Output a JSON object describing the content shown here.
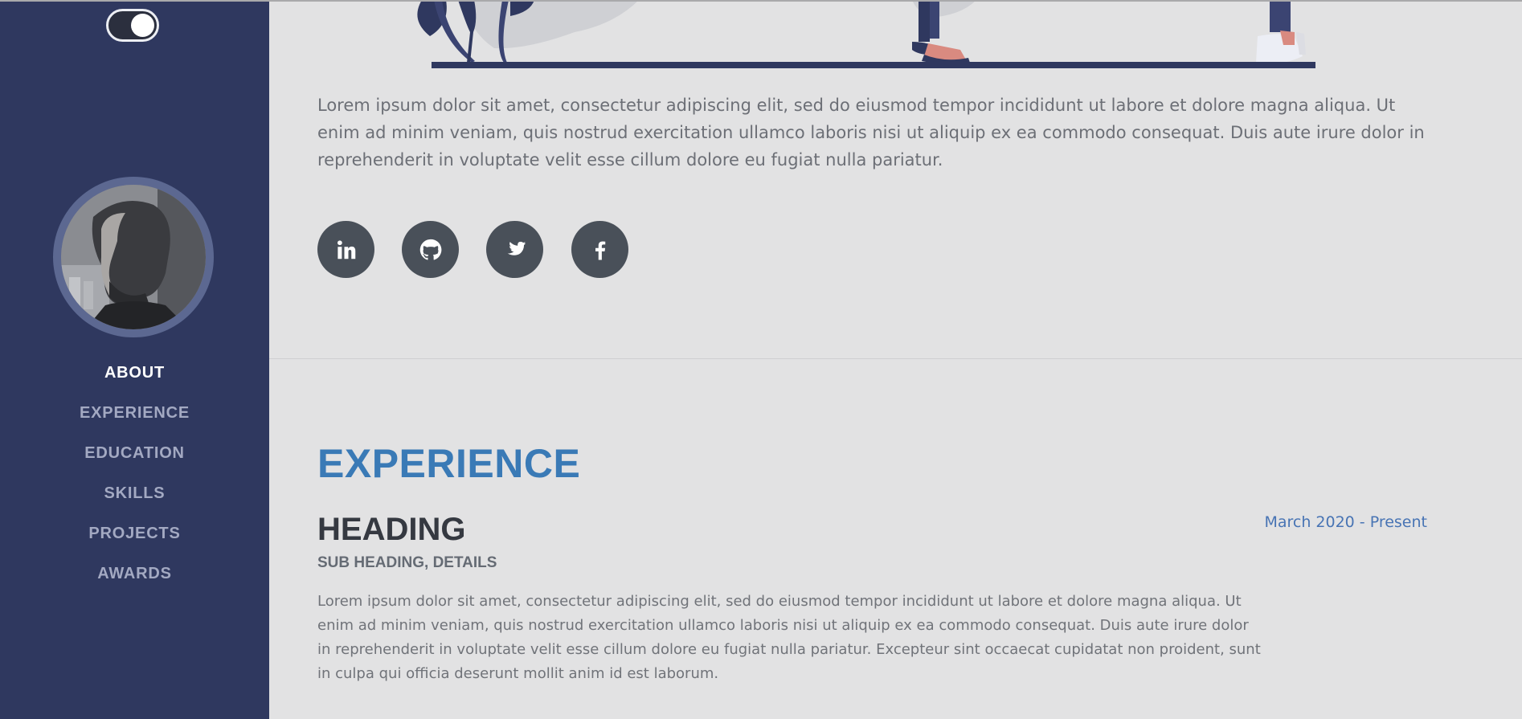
{
  "theme_toggle": {
    "state": "on"
  },
  "sidebar": {
    "avatar_icon": "profile-photo",
    "nav_items": [
      {
        "label": "ABOUT",
        "active": true
      },
      {
        "label": "EXPERIENCE",
        "active": false
      },
      {
        "label": "EDUCATION",
        "active": false
      },
      {
        "label": "SKILLS",
        "active": false
      },
      {
        "label": "PROJECTS",
        "active": false
      },
      {
        "label": "AWARDS",
        "active": false
      }
    ]
  },
  "about": {
    "intro": "Lorem ipsum dolor sit amet, consectetur adipiscing elit, sed do eiusmod tempor incididunt ut labore et dolore magna aliqua. Ut enim ad minim veniam, quis nostrud exercitation ullamco laboris nisi ut aliquip ex ea commodo consequat. Duis aute irure dolor in reprehenderit in voluptate velit esse cillum dolore eu fugiat nulla pariatur.",
    "social_icons": [
      "linkedin-icon",
      "github-icon",
      "twitter-icon",
      "facebook-icon"
    ]
  },
  "experience": {
    "section_title": "EXPERIENCE",
    "entries": [
      {
        "heading": "HEADING",
        "subheading": "SUB HEADING, DETAILS",
        "date": "March 2020 - Present",
        "body": "Lorem ipsum dolor sit amet, consectetur adipiscing elit, sed do eiusmod tempor incididunt ut labore et dolore magna aliqua. Ut enim ad minim veniam, quis nostrud exercitation ullamco laboris nisi ut aliquip ex ea commodo consequat. Duis aute irure dolor in reprehenderit in voluptate velit esse cillum dolore eu fugiat nulla pariatur. Excepteur sint occaecat cupidatat non proident, sunt in culpa qui officia deserunt mollit anim id est laborum."
      }
    ]
  },
  "colors": {
    "sidebar_bg": "#2f385f",
    "page_bg": "#e2e2e3",
    "accent": "#3a7ab6",
    "date_text": "#4874b4",
    "social_bg": "#495059"
  }
}
